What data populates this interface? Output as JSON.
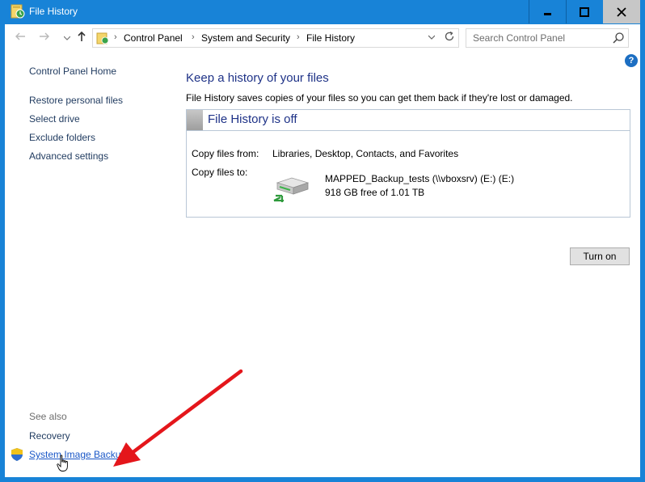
{
  "window": {
    "title": "File History",
    "app_icon": "file-history-icon",
    "controls": [
      "minimize",
      "maximize",
      "close"
    ]
  },
  "navbar": {
    "breadcrumb": [
      "Control Panel",
      "System and Security",
      "File History"
    ],
    "search_placeholder": "Search Control Panel",
    "help_label": "?"
  },
  "left_pane": {
    "home": "Control Panel Home",
    "links": [
      "Restore personal files",
      "Select drive",
      "Exclude folders",
      "Advanced settings"
    ],
    "see_also_label": "See also",
    "see_also": [
      "Recovery",
      "System Image Backup"
    ]
  },
  "content": {
    "heading": "Keep a history of your files",
    "description": "File History saves copies of your files so you can get them back if they're lost or damaged.",
    "status": "File History is off",
    "copy_from_label": "Copy files from:",
    "copy_from_value": "Libraries, Desktop, Contacts, and Favorites",
    "copy_to_label": "Copy files to:",
    "drive_name": "MAPPED_Backup_tests (\\\\vboxsrv) (E:) (E:)",
    "drive_free": "918 GB free of 1.01 TB",
    "turn_on_button": "Turn on"
  },
  "colors": {
    "titlebar": "#1883d7",
    "heading": "#1e3287",
    "link": "#1f3a5f",
    "hover_link": "#1a57c7",
    "annotation_arrow": "#e4161b"
  }
}
